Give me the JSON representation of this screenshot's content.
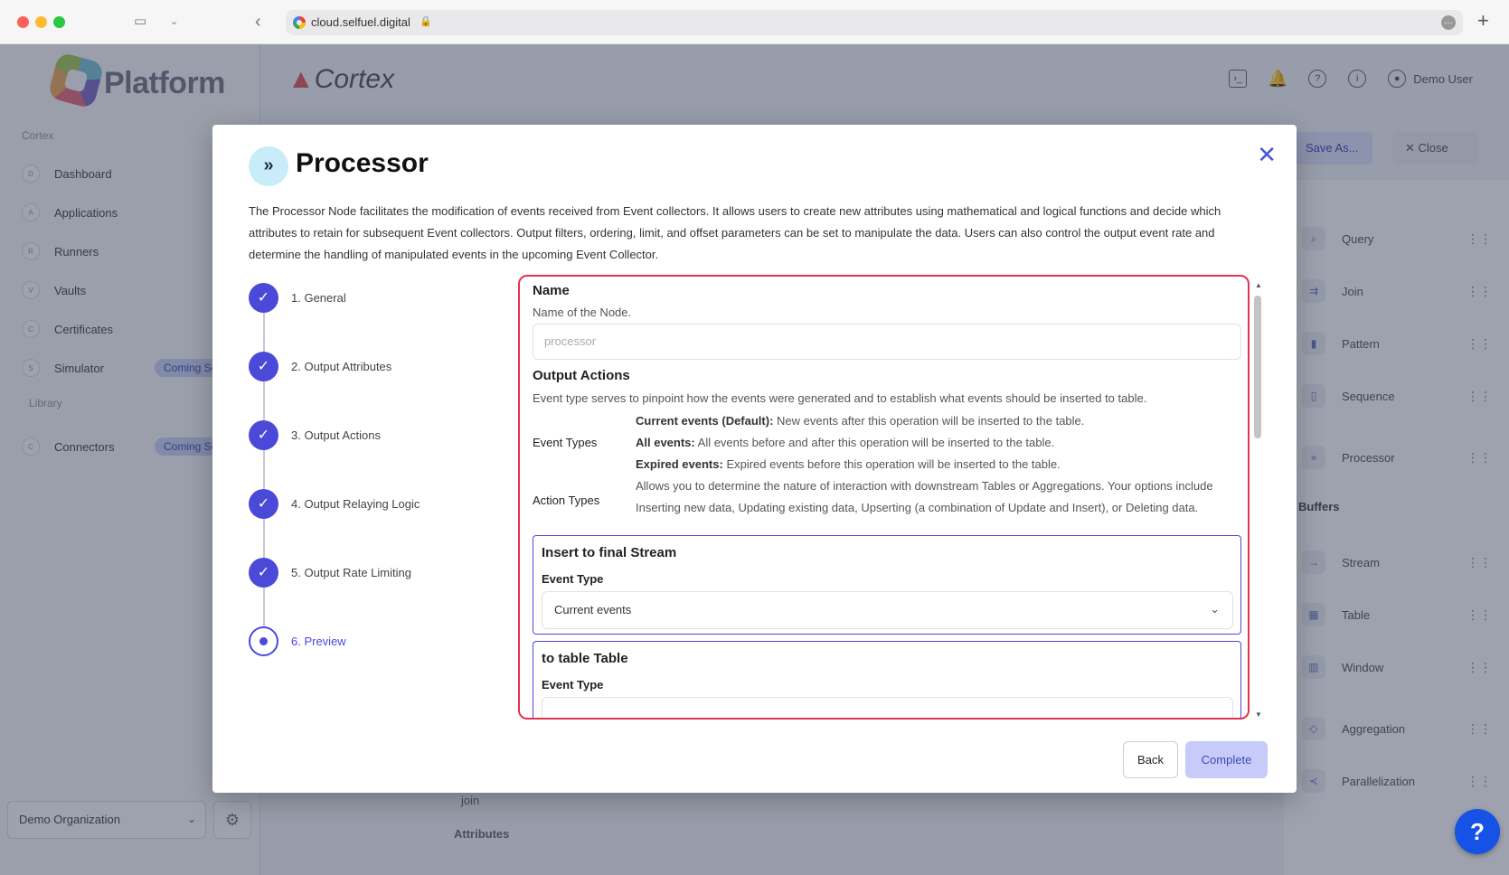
{
  "browser": {
    "url": "cloud.selfuel.digital",
    "lock_icon": "lock-icon"
  },
  "app": {
    "logo_text": "Platform",
    "product_logo": "Cortex",
    "user_name": "Demo User",
    "sidebar": {
      "section_cortex": "Cortex",
      "items": [
        {
          "badge": "D",
          "label": "Dashboard"
        },
        {
          "badge": "A",
          "label": "Applications"
        },
        {
          "badge": "R",
          "label": "Runners"
        },
        {
          "badge": "V",
          "label": "Vaults"
        },
        {
          "badge": "C",
          "label": "Certificates"
        },
        {
          "badge": "S",
          "label": "Simulator",
          "tag": "Coming Soon"
        }
      ],
      "section_library": "Library",
      "library_items": [
        {
          "badge": "C",
          "label": "Connectors",
          "tag": "Coming Soon"
        }
      ],
      "organization": "Demo Organization"
    },
    "toolbar": {
      "save_as": "Save As...",
      "close": "Close"
    },
    "palette": {
      "items_top": [
        "Query",
        "Join",
        "Pattern",
        "Sequence",
        "Processor"
      ],
      "buffers_heading": "Buffers",
      "buffers": [
        "Stream",
        "Table",
        "Window"
      ],
      "items_bottom": [
        "Aggregation",
        "Parallelization"
      ]
    },
    "canvas": {
      "node_text": "join",
      "attributes_label": "Attributes"
    },
    "help_label": "?"
  },
  "modal": {
    "title": "Processor",
    "description": "The Processor Node facilitates the modification of events received from Event collectors. It allows users to create new attributes using mathematical and logical functions and decide which attributes to retain for subsequent Event collectors. Output filters, ordering, limit, and offset parameters can be set to manipulate the data. Users can also control the output event rate and determine the handling of manipulated events in the upcoming Event Collector.",
    "steps": [
      {
        "label": "1. General",
        "state": "done"
      },
      {
        "label": "2. Output Attributes",
        "state": "done"
      },
      {
        "label": "3. Output Actions",
        "state": "done"
      },
      {
        "label": "4. Output Relaying Logic",
        "state": "done"
      },
      {
        "label": "5. Output Rate Limiting",
        "state": "done"
      },
      {
        "label": "6. Preview",
        "state": "active"
      }
    ],
    "form": {
      "name_heading": "Name",
      "name_sub": "Name of the Node.",
      "name_value": "processor",
      "actions_heading": "Output Actions",
      "actions_sub": "Event type serves to pinpoint how the events were generated and to establish what events should be inserted to table.",
      "event_types_label": "Event Types",
      "event_types": [
        {
          "name": "Current events (Default):",
          "desc": " New events after this operation will be inserted to the table."
        },
        {
          "name": "All events:",
          "desc": " All events before and after this operation will be inserted to the table."
        },
        {
          "name": "Expired events:",
          "desc": " Expired events before this operation will be inserted to the table."
        }
      ],
      "action_types_label": "Action Types",
      "action_types_text": "Allows you to determine the nature of interaction with downstream Tables or Aggregations. Your options include Inserting new data, Updating existing data, Upserting (a combination of Update and Insert), or Deleting data.",
      "cards": [
        {
          "title": "Insert to final Stream",
          "field_label": "Event Type",
          "value": "Current events"
        },
        {
          "title": "to table Table",
          "field_label": "Event Type",
          "value": ""
        }
      ]
    },
    "buttons": {
      "back": "Back",
      "complete": "Complete"
    }
  }
}
